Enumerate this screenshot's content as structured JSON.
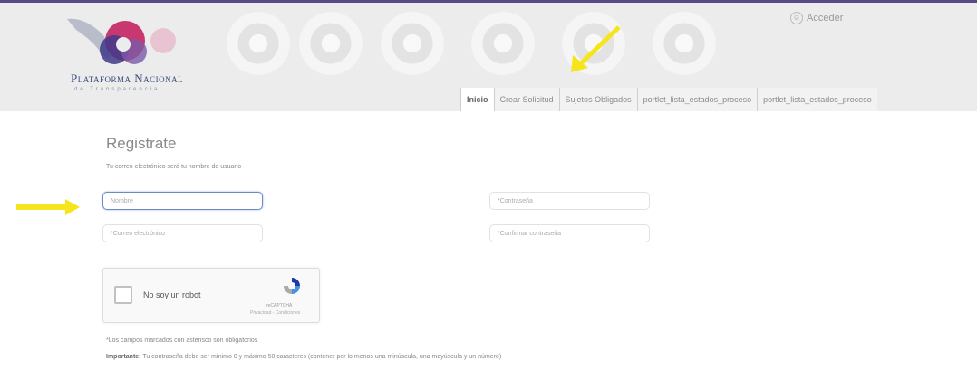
{
  "header": {
    "brand_title": "Plataforma Nacional",
    "brand_subtitle": "de Transparencia",
    "login_label": "Acceder"
  },
  "nav": {
    "tabs": [
      {
        "label": "Inicio",
        "active": true
      },
      {
        "label": "Crear Solicitud",
        "active": false
      },
      {
        "label": "Sujetos Obligados",
        "active": false
      },
      {
        "label": "portlet_lista_estados_proceso",
        "active": false
      },
      {
        "label": "portlet_lista_estados_proceso",
        "active": false
      }
    ]
  },
  "form": {
    "title": "Registrate",
    "intro": "Tu correo electrónico será tu nombre de usuario",
    "fields": {
      "name_placeholder": "Nombre",
      "password_placeholder": "*Contraseña",
      "email_placeholder": "*Correo electrónico",
      "confirm_password_placeholder": "*Confirmar contraseña"
    },
    "captcha": {
      "label": "No soy un robot",
      "brand": "reCAPTCHA",
      "links": "Privacidad - Condiciones"
    },
    "required_note": "*Los campos marcados con asterisco son obligatorios",
    "important_label": "Importante:",
    "important_text": "Tu contraseña debe ser mínimo 8 y máximo 50 caracteres (contener por lo menos una minúscula, una mayúscula y un número)"
  },
  "colors": {
    "accent_line": "#5b4a8a",
    "active_tab_border": "#c0392b",
    "annotation_arrow": "#f5e51a"
  }
}
